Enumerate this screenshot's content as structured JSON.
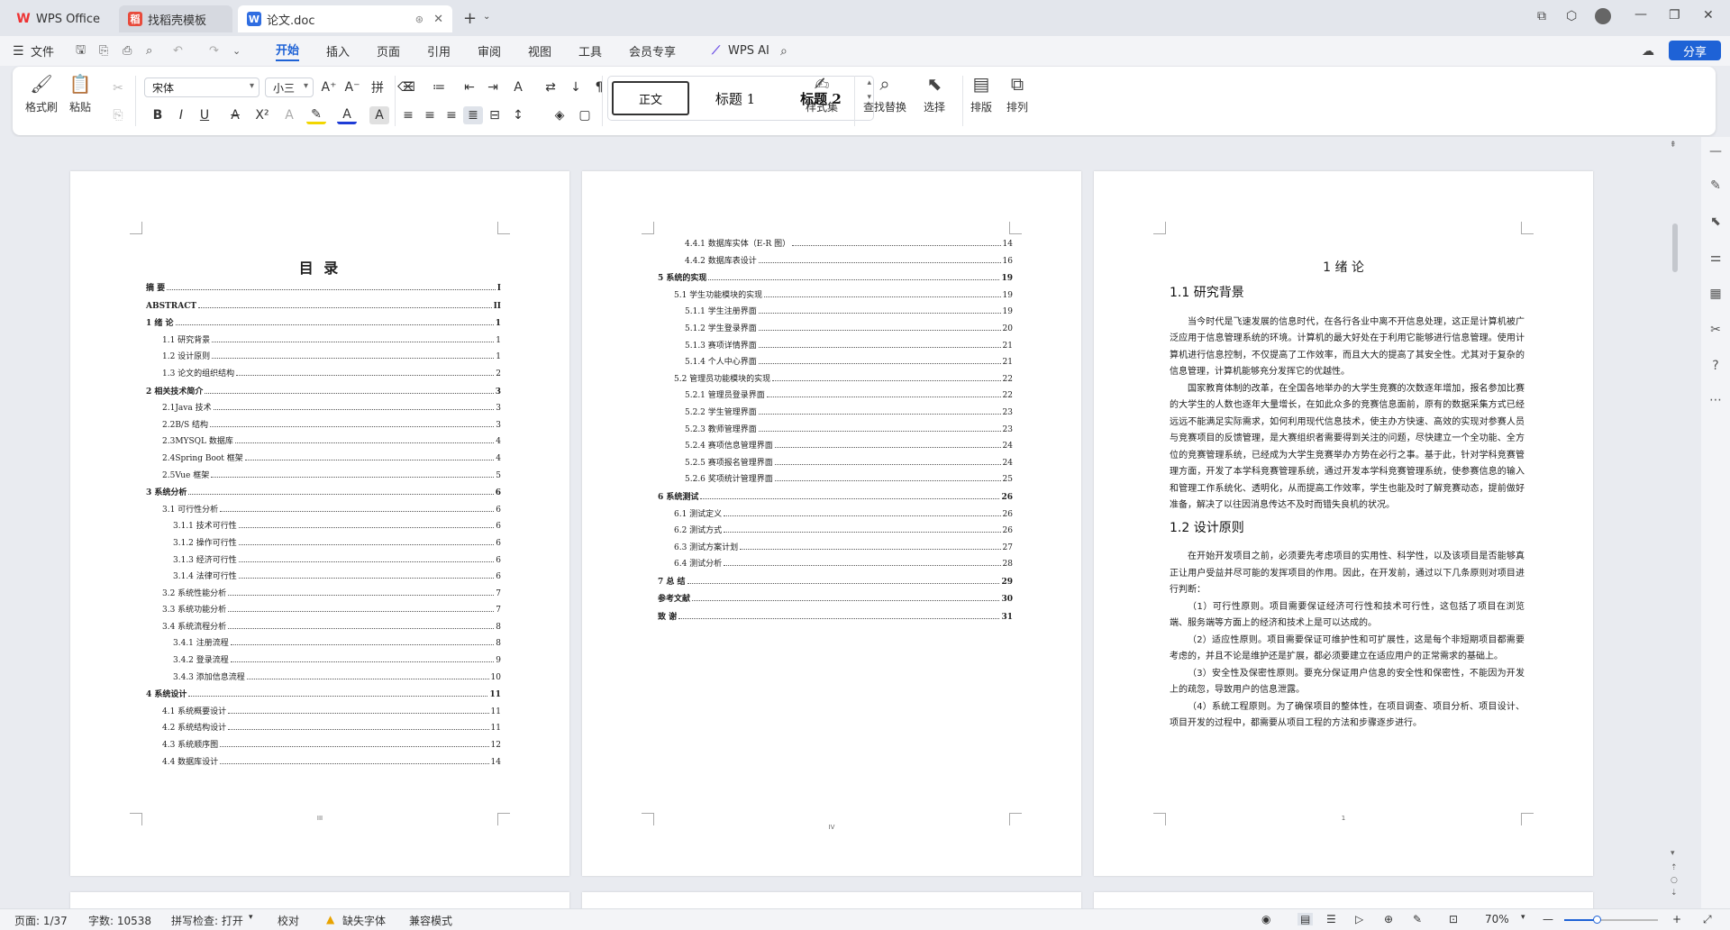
{
  "tabs": [
    {
      "label": "WPS Office"
    },
    {
      "label": "找稻壳模板"
    },
    {
      "label": "论文.doc"
    }
  ],
  "menu": {
    "file": "文件",
    "items": [
      "开始",
      "插入",
      "页面",
      "引用",
      "审阅",
      "视图",
      "工具",
      "会员专享"
    ],
    "ai": "WPS AI",
    "share": "分享"
  },
  "ribbon": {
    "format_painter": "格式刷",
    "paste": "粘贴",
    "font_name": "宋体",
    "font_size": "小三",
    "styles": [
      "正文",
      "标题 1",
      "标题 2"
    ],
    "style_set": "样式集",
    "find_replace": "查找替换",
    "select": "选择",
    "layout": "排版",
    "arrange": "排列"
  },
  "toc1": {
    "title": "目 录",
    "rows": [
      {
        "t": "摘 要",
        "p": "I",
        "lv": 0
      },
      {
        "t": "ABSTRACT",
        "p": "II",
        "lv": 0
      },
      {
        "t": "1 绪 论",
        "p": "1",
        "lv": 0
      },
      {
        "t": "1.1 研究背景",
        "p": "1",
        "lv": 1
      },
      {
        "t": "1.2 设计原则",
        "p": "1",
        "lv": 1
      },
      {
        "t": "1.3 论文的组织结构",
        "p": "2",
        "lv": 1
      },
      {
        "t": "2 相关技术简介",
        "p": "3",
        "lv": 0
      },
      {
        "t": "2.1Java 技术",
        "p": "3",
        "lv": 1
      },
      {
        "t": "2.2B/S 结构",
        "p": "3",
        "lv": 1
      },
      {
        "t": "2.3MYSQL 数据库",
        "p": "4",
        "lv": 1
      },
      {
        "t": "2.4Spring Boot 框架",
        "p": "4",
        "lv": 1
      },
      {
        "t": "2.5Vue 框架",
        "p": "5",
        "lv": 1
      },
      {
        "t": "3 系统分析",
        "p": "6",
        "lv": 0
      },
      {
        "t": "3.1 可行性分析",
        "p": "6",
        "lv": 1
      },
      {
        "t": "3.1.1 技术可行性",
        "p": "6",
        "lv": 2
      },
      {
        "t": "3.1.2 操作可行性",
        "p": "6",
        "lv": 2
      },
      {
        "t": "3.1.3 经济可行性",
        "p": "6",
        "lv": 2
      },
      {
        "t": "3.1.4 法律可行性",
        "p": "6",
        "lv": 2
      },
      {
        "t": "3.2 系统性能分析",
        "p": "7",
        "lv": 1
      },
      {
        "t": "3.3 系统功能分析",
        "p": "7",
        "lv": 1
      },
      {
        "t": "3.4 系统流程分析",
        "p": "8",
        "lv": 1
      },
      {
        "t": "3.4.1 注册流程",
        "p": "8",
        "lv": 2
      },
      {
        "t": "3.4.2 登录流程",
        "p": "9",
        "lv": 2
      },
      {
        "t": "3.4.3 添加信息流程",
        "p": "10",
        "lv": 2
      },
      {
        "t": "4 系统设计",
        "p": "11",
        "lv": 0
      },
      {
        "t": "4.1 系统概要设计",
        "p": "11",
        "lv": 1
      },
      {
        "t": "4.2 系统结构设计",
        "p": "11",
        "lv": 1
      },
      {
        "t": "4.3 系统顺序图",
        "p": "12",
        "lv": 1
      },
      {
        "t": "4.4 数据库设计",
        "p": "14",
        "lv": 1
      }
    ],
    "footer": "III"
  },
  "toc2": {
    "rows": [
      {
        "t": "4.4.1 数据库实体（E-R 图）",
        "p": "14",
        "lv": 2
      },
      {
        "t": "4.4.2 数据库表设计",
        "p": "16",
        "lv": 2
      },
      {
        "t": "5 系统的实现",
        "p": "19",
        "lv": 0
      },
      {
        "t": "5.1 学生功能模块的实现",
        "p": "19",
        "lv": 1
      },
      {
        "t": "5.1.1 学生注册界面",
        "p": "19",
        "lv": 2
      },
      {
        "t": "5.1.2 学生登录界面",
        "p": "20",
        "lv": 2
      },
      {
        "t": "5.1.3 赛项详情界面",
        "p": "21",
        "lv": 2
      },
      {
        "t": "5.1.4 个人中心界面",
        "p": "21",
        "lv": 2
      },
      {
        "t": "5.2 管理员功能模块的实现",
        "p": "22",
        "lv": 1
      },
      {
        "t": "5.2.1 管理员登录界面",
        "p": "22",
        "lv": 2
      },
      {
        "t": "5.2.2 学生管理界面",
        "p": "23",
        "lv": 2
      },
      {
        "t": "5.2.3 教师管理界面",
        "p": "23",
        "lv": 2
      },
      {
        "t": "5.2.4 赛项信息管理界面",
        "p": "24",
        "lv": 2
      },
      {
        "t": "5.2.5 赛项报名管理界面",
        "p": "24",
        "lv": 2
      },
      {
        "t": "5.2.6 奖项统计管理界面",
        "p": "25",
        "lv": 2
      },
      {
        "t": "6 系统测试",
        "p": "26",
        "lv": 0
      },
      {
        "t": "6.1 测试定义",
        "p": "26",
        "lv": 1
      },
      {
        "t": "6.2 测试方式",
        "p": "26",
        "lv": 1
      },
      {
        "t": "6.3 测试方案计划",
        "p": "27",
        "lv": 1
      },
      {
        "t": "6.4 测试分析",
        "p": "28",
        "lv": 1
      },
      {
        "t": "7 总 结",
        "p": "29",
        "lv": 0
      },
      {
        "t": "参考文献",
        "p": "30",
        "lv": 0
      },
      {
        "t": "致 谢",
        "p": "31",
        "lv": 0
      }
    ],
    "footer": "IV"
  },
  "page3": {
    "chapter": "1 绪 论",
    "h1": "1.1 研究背景",
    "p1": "当今时代是飞速发展的信息时代，在各行各业中离不开信息处理，这正是计算机被广泛应用于信息管理系统的环境。计算机的最大好处在于利用它能够进行信息管理。使用计算机进行信息控制，不仅提高了工作效率，而且大大的提高了其安全性。尤其对于复杂的信息管理，计算机能够充分发挥它的优越性。",
    "p2": "国家教育体制的改革，在全国各地举办的大学生竞赛的次数逐年增加，报名参加比赛的大学生的人数也逐年大量增长，在如此众多的竞赛信息面前，原有的数据采集方式已经远远不能满足实际需求，如何利用现代信息技术，使主办方快速、高效的实现对参赛人员与竞赛项目的反馈管理，是大赛组织者需要得到关注的问题，尽快建立一个全功能、全方位的竞赛管理系统，已经成为大学生竞赛举办方势在必行之事。基于此，针对学科竞赛管理方面，开发了本学科竞赛管理系统，通过开发本学科竞赛管理系统，使参赛信息的输入和管理工作系统化、透明化，从而提高工作效率，学生也能及时了解竞赛动态，提前做好准备，解决了以往因消息传达不及时而错失良机的状况。",
    "h2": "1.2 设计原则",
    "p3": "在开始开发项目之前，必须要先考虑项目的实用性、科学性，以及该项目是否能够真正让用户受益并尽可能的发挥项目的作用。因此，在开发前，通过以下几条原则对项目进行判断：",
    "p4": "（1）可行性原则。项目需要保证经济可行性和技术可行性，这包括了项目在浏览端、服务端等方面上的经济和技术上是可以达成的。",
    "p5": "（2）适应性原则。项目需要保证可维护性和可扩展性，这是每个非短期项目都需要考虑的，并且不论是维护还是扩展，都必须要建立在适应用户的正常需求的基础上。",
    "p6": "（3）安全性及保密性原则。要充分保证用户信息的安全性和保密性，不能因为开发上的疏忽，导致用户的信息泄露。",
    "p7": "（4）系统工程原则。为了确保项目的整体性，在项目调查、项目分析、项目设计、项目开发的过程中，都需要从项目工程的方法和步骤逐步进行。",
    "footer": "1"
  },
  "status": {
    "page": "页面: 1/37",
    "words": "字数: 10538",
    "spell": "拼写检查: 打开",
    "proof": "校对",
    "missing_font": "缺失字体",
    "compat": "兼容模式",
    "zoom": "70%"
  }
}
